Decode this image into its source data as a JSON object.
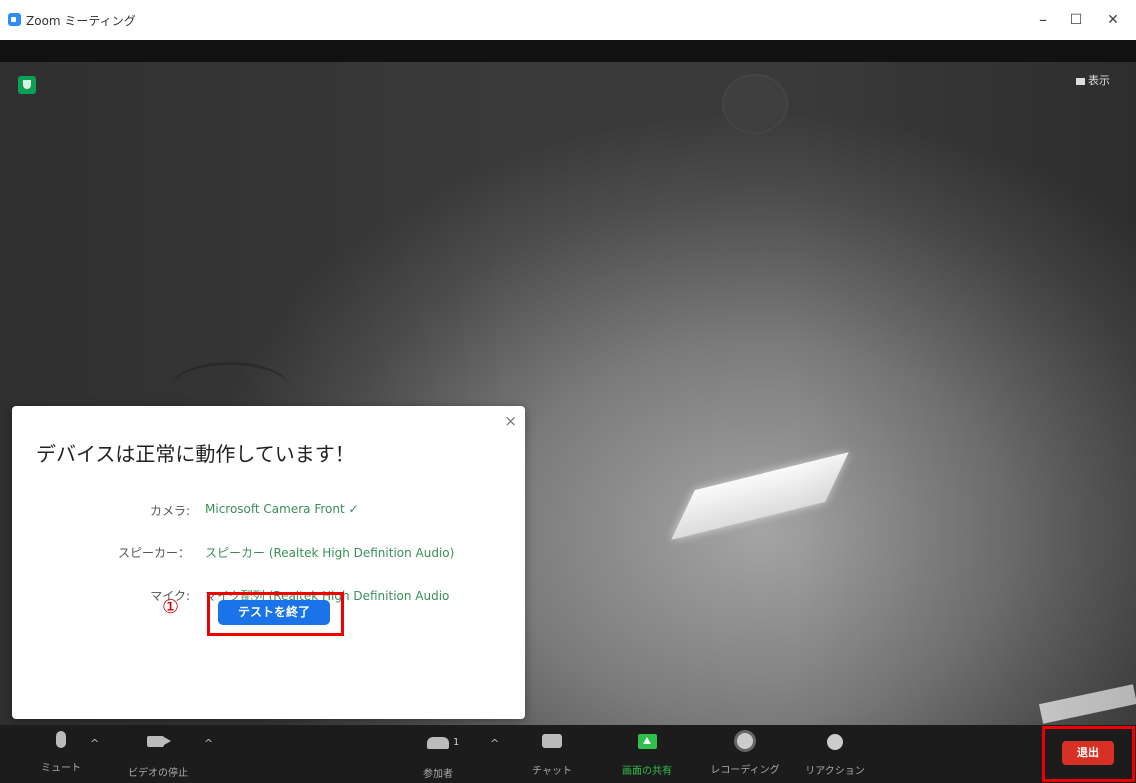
{
  "window": {
    "title": "Zoom ミーティング",
    "minimize": "–",
    "maximize": "☐",
    "close": "✕"
  },
  "video": {
    "view_label": "表示"
  },
  "dialog": {
    "title": "デバイスは正常に動作しています！",
    "close": "×",
    "rows": [
      {
        "label": "カメラ:",
        "value": "Microsoft Camera Front ✓"
      },
      {
        "label": "スピーカー：",
        "value": "スピーカー (Realtek High Definition Audio)"
      },
      {
        "label": "マイク:",
        "value": "マイク配列 (Realtek High Definition Audio"
      }
    ],
    "step_marker": "①",
    "end_test_label": "テストを終了"
  },
  "toolbar": {
    "mute": "ミュート",
    "stop_video": "ビデオの停止",
    "participants": "参加者",
    "participants_count": "1",
    "chat": "チャット",
    "share_screen": "画面の共有",
    "recording": "レコーディング",
    "reactions": "リアクション",
    "leave": "退出",
    "caret": "^"
  },
  "colors": {
    "share_green": "#2fbf4a",
    "leave_red": "#d93025",
    "highlight_red": "#e00000",
    "dialog_accent_blue": "#1a73e8",
    "device_value_green": "#3a8f59"
  }
}
